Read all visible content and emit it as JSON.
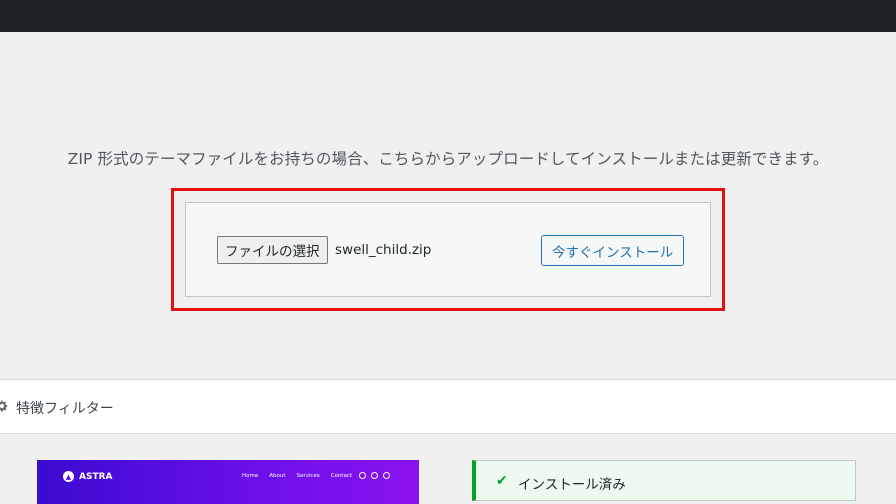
{
  "upload": {
    "description": "ZIP 形式のテーマファイルをお持ちの場合、こちらからアップロードしてインストールまたは更新できます。",
    "choose_file_label": "ファイルの選択",
    "selected_file": "swell_child.zip",
    "install_now_label": "今すぐインストール"
  },
  "filter": {
    "label": "特徴フィルター",
    "icon": "gear-icon"
  },
  "theme_preview": {
    "brand": "ASTRA",
    "nav": [
      "Home",
      "About",
      "Services",
      "Contact"
    ]
  },
  "installed": {
    "label": "インストール済み",
    "icon": "check-icon"
  },
  "colors": {
    "admin_bar": "#1d2327",
    "highlight": "#e31010",
    "accent": "#2271b1",
    "success": "#00a32a"
  }
}
